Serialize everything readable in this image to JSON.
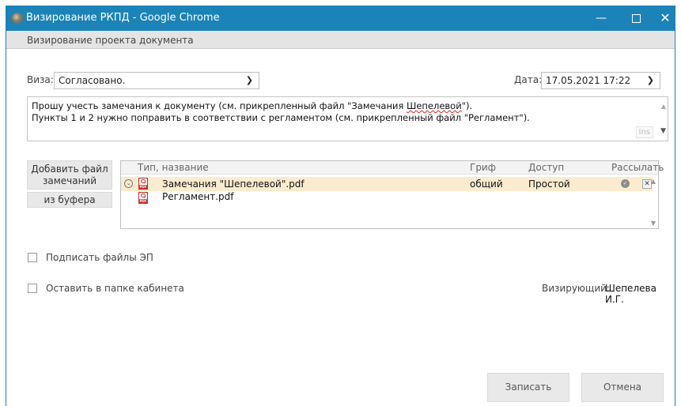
{
  "window": {
    "title": "Визирование РКПД - Google Chrome",
    "controls": {
      "minimize": "—",
      "close": "✕"
    }
  },
  "header": {
    "title": "Визирование проекта документа"
  },
  "visa": {
    "label": "Виза:",
    "value": "Согласовано."
  },
  "date": {
    "label": "Дата:",
    "value": "17.05.2021 17:22"
  },
  "comment": {
    "line1_before": "Прошу учесть замечания к документу (см. прикрепленный файл \"Замечания ",
    "line1_spell": "Шепелевой",
    "line1_after": "\").",
    "line2": "Пункты 1 и 2 нужно поправить в соответствии с регламентом (см. прикрепленный файл \"Регламент\").",
    "ins_label": "Ins"
  },
  "attachments": {
    "add_button_line1": "Добавить файл",
    "add_button_line2": "замечаний",
    "from_buffer_button": "из буфера",
    "columns": {
      "type_name": "Тип, название",
      "grif": "Гриф",
      "access": "Доступ",
      "send": "Рассылать"
    },
    "rows": [
      {
        "name": "Замечания \"Шепелевой\".pdf",
        "grif": "общий",
        "access": "Простой",
        "selected": true,
        "icon": "pdf-icon"
      },
      {
        "name": "Регламент.pdf",
        "grif": "",
        "access": "",
        "selected": false,
        "icon": "pdf-icon"
      }
    ]
  },
  "options": {
    "sign_files": "Подписать файлы ЭП",
    "keep_in_folder": "Оставить в папке кабинета"
  },
  "signer": {
    "label": "Визирующий:",
    "name": "Шепелева И.Г."
  },
  "footer": {
    "save": "Записать",
    "cancel": "Отмена"
  },
  "colors": {
    "titlebar": "#1b83b8",
    "selected_row": "#fbeccf",
    "pdf_red": "#c62a2a"
  }
}
